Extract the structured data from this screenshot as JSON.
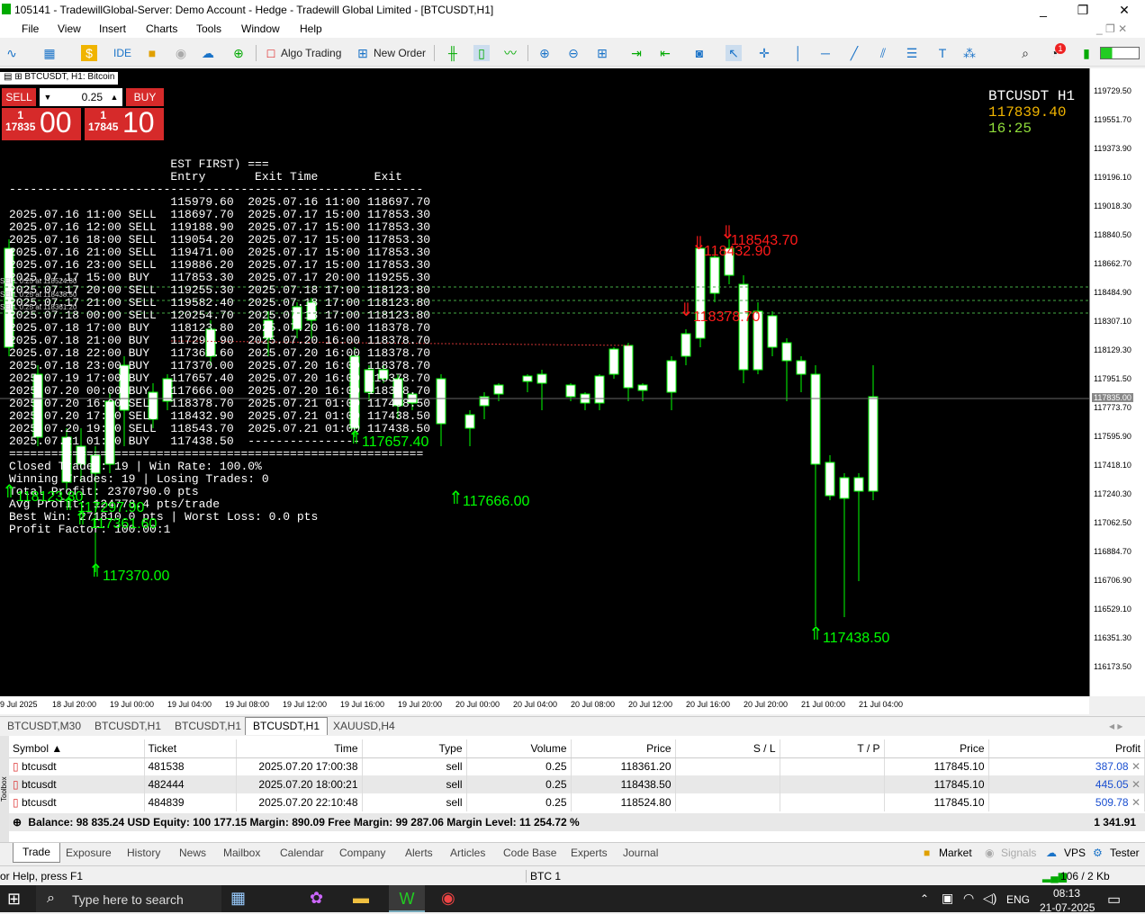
{
  "window": {
    "title": "105141 - TradewillGlobal-Server: Demo Account - Hedge - Tradewill Global Limited - [BTCUSDT,H1]",
    "controls": [
      "_",
      "❐",
      "✕"
    ]
  },
  "menu": [
    "File",
    "View",
    "Insert",
    "Charts",
    "Tools",
    "Window",
    "Help"
  ],
  "toolbar": {
    "ide": "IDE",
    "algo_trading": "Algo Trading",
    "new_order": "New Order",
    "notifications_count": "1"
  },
  "chart": {
    "header": "BTCUSDT, H1: Bitcoin",
    "symbol_tf": "BTCUSDT  H1",
    "price": "117839.40",
    "time": "16:25",
    "colors": {
      "background": "#000000",
      "up": "#00ff00",
      "down": "#ff1a1a",
      "candle_body": "#ffffff"
    },
    "one_click": {
      "sell_label": "SELL",
      "buy_label": "BUY",
      "volume": "0.25",
      "sell_price_small": "1\n17835",
      "sell_price_big": "00",
      "buy_price_small": "1\n17845",
      "buy_price_big": "10"
    },
    "report_lines": [
      "                       EST FIRST) ===",
      "                       Entry       Exit Time        Exit",
      "-----------------------------------------------------------",
      "                       115979.60  2025.07.16 11:00 118697.70",
      "2025.07.16 11:00 SELL  118697.70  2025.07.17 15:00 117853.30",
      "2025.07.16 12:00 SELL  119188.90  2025.07.17 15:00 117853.30",
      "2025.07.16 18:00 SELL  119054.20  2025.07.17 15:00 117853.30",
      "2025.07.16 21:00 SELL  119471.00  2025.07.17 15:00 117853.30",
      "2025.07.16 23:00 SELL  119886.20  2025.07.17 15:00 117853.30",
      "2025.07.17 15:00 BUY   117853.30  2025.07.17 20:00 119255.30",
      "2025.07.17 20:00 SELL  119255.30  2025.07.18 17:00 118123.80",
      "2025.07.17 21:00 SELL  119582.40  2025.07.18 17:00 118123.80",
      "2025.07.18 00:00 SELL  120254.70  2025.07.18 17:00 118123.80",
      "2025.07.18 17:00 BUY   118123.80  2025.07.20 16:00 118378.70",
      "2025.07.18 21:00 BUY   117297.90  2025.07.20 16:00 118378.70",
      "2025.07.18 22:00 BUY   117361.60  2025.07.20 16:00 118378.70",
      "2025.07.18 23:00 BUY   117370.00  2025.07.20 16:00 118378.70",
      "2025.07.19 17:00 BUY   117657.40  2025.07.20 16:00 118378.70",
      "2025.07.20 00:00 BUY   117666.00  2025.07.20 16:00 118378.70",
      "2025.07.20 16:00 SELL  118378.70  2025.07.21 01:00 117438.50",
      "2025.07.20 17:00 SELL  118432.90  2025.07.21 01:00 117438.50",
      "2025.07.20 19:00 SELL  118543.70  2025.07.21 01:00 117438.50",
      "2025.07.21 01:00 BUY   117438.50  ----------------",
      "===========================================================",
      "Closed Trades: 19 | Win Rate: 100.0%",
      "Winning Trades: 19 | Losing Trades: 0",
      "Total Profit: 2370790.0 pts",
      "Avg Profit: 124778.4 pts/trade",
      "Best Win: 271810.0 pts | Worst Loss: 0.0 pts",
      "Profit Factor: 100.00:1"
    ],
    "position_lines": [
      "SELL 0.25 at 118524.80",
      "SELL 0.25 at 118438.50",
      "SELL 0.25 at 118361.20"
    ],
    "arrow_labels_green": [
      "118123.80",
      "117297.90",
      "117361.60",
      "117370.00",
      "117657.40",
      "117666.00",
      "117438.50"
    ],
    "arrow_labels_red": [
      "118543.70",
      "118432.90",
      "118378.70"
    ],
    "price_scale": [
      "119729.50",
      "119551.70",
      "119373.90",
      "119196.10",
      "119018.30",
      "118840.50",
      "118662.70",
      "118484.90",
      "118307.10",
      "118129.30",
      "117951.50",
      "117773.70",
      "117595.90",
      "117418.10",
      "117240.30",
      "117062.50",
      "116884.70",
      "116706.90",
      "116529.10",
      "116351.30",
      "116173.50"
    ],
    "current_price_tag": "117835.00",
    "time_scale": [
      "9 Jul 2025",
      "18 Jul 20:00",
      "19 Jul 00:00",
      "19 Jul 04:00",
      "19 Jul 08:00",
      "19 Jul 12:00",
      "19 Jul 16:00",
      "19 Jul 20:00",
      "20 Jul 00:00",
      "20 Jul 04:00",
      "20 Jul 08:00",
      "20 Jul 12:00",
      "20 Jul 16:00",
      "20 Jul 20:00",
      "21 Jul 00:00",
      "21 Jul 04:00"
    ]
  },
  "chart_tabs": [
    "BTCUSDT,M30",
    "BTCUSDT,H1",
    "BTCUSDT,H1",
    "BTCUSDT,H1",
    "XAUUSD,H4"
  ],
  "trade_table": {
    "headers": [
      "Symbol",
      "Ticket",
      "Time",
      "Type",
      "Volume",
      "Price",
      "S / L",
      "T / P",
      "Price",
      "Profit"
    ],
    "rows": [
      [
        "btcusdt",
        "481538",
        "2025.07.20 17:00:38",
        "sell",
        "0.25",
        "118361.20",
        "",
        "",
        "117845.10",
        "387.08"
      ],
      [
        "btcusdt",
        "482444",
        "2025.07.20 18:00:21",
        "sell",
        "0.25",
        "118438.50",
        "",
        "",
        "117845.10",
        "445.05"
      ],
      [
        "btcusdt",
        "484839",
        "2025.07.20 22:10:48",
        "sell",
        "0.25",
        "118524.80",
        "",
        "",
        "117845.10",
        "509.78"
      ]
    ],
    "balance_line": "Balance: 98 835.24 USD  Equity: 100 177.15  Margin: 890.09  Free Margin: 99 287.06  Margin Level: 11 254.72 %",
    "total_profit": "1 341.91"
  },
  "terminal_tabs": [
    "Trade",
    "Exposure",
    "History",
    "News",
    "Mailbox",
    "Calendar",
    "Company",
    "Alerts",
    "Articles",
    "Code Base",
    "Experts",
    "Journal"
  ],
  "terminal_right": [
    "Market",
    "Signals",
    "VPS",
    "Tester"
  ],
  "toolbox_label": "Toolbox",
  "status": {
    "help": "or Help, press F1",
    "profile": "BTC 1",
    "traffic": "106 / 2 Kb"
  },
  "taskbar": {
    "search_placeholder": "Type here to search",
    "lang": "ENG",
    "time": "08:13",
    "date": "21-07-2025"
  }
}
